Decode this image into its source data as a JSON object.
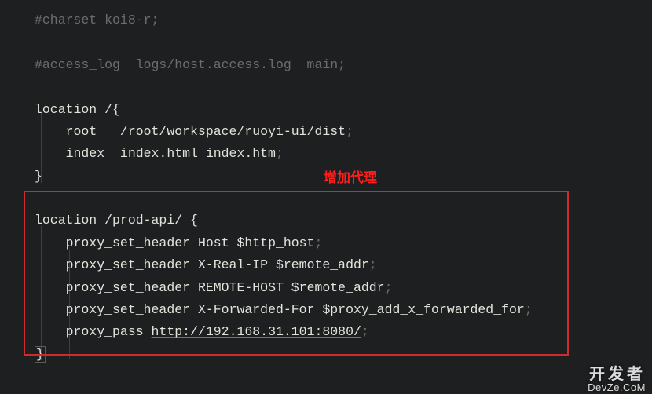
{
  "annotation": "增加代理",
  "line1": "#charset koi8-r;",
  "line2_a": "#access_log  logs/host.access.log  main;",
  "loc1_key": "location",
  "loc1_path": " /",
  "loc1_brace": "{",
  "root_kw": "root",
  "root_val": "   /root/workspace/ruoyi-ui/dist",
  "semi": ";",
  "index_kw": "index",
  "index_val": "  index.html index.htm",
  "close_brace": "}",
  "loc2_key": "location",
  "loc2_path": " /prod-api/ ",
  "loc2_brace": "{",
  "p1_kw": "proxy_set_header",
  "p1_val": " Host $http_host",
  "p2_kw": "proxy_set_header",
  "p2_val": " X-Real-IP $remote_addr",
  "p3_kw": "proxy_set_header",
  "p3_val": " REMOTE-HOST $remote_addr",
  "p4_kw": "proxy_set_header",
  "p4_val": " X-Forwarded-For $proxy_add_x_forwarded_for",
  "pp_kw": "proxy_pass",
  "pp_val": "http://192.168.31.101:8080/",
  "watermark_top": "开发者",
  "watermark_bot": "DevZe.CoM"
}
